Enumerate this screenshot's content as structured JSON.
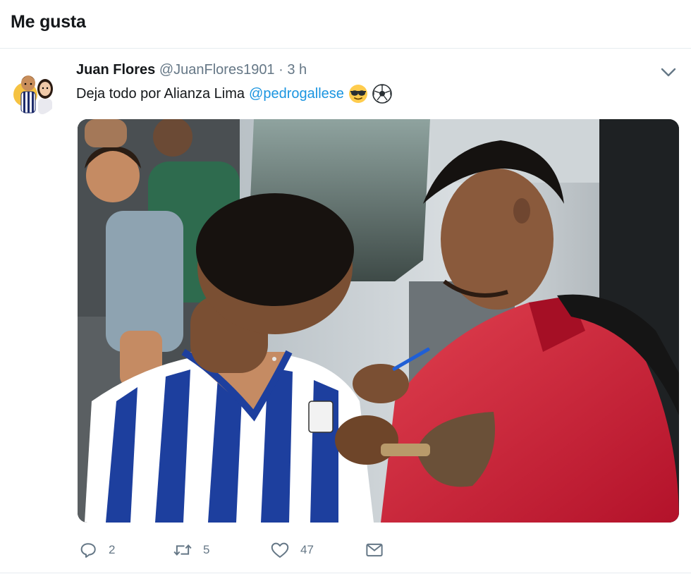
{
  "header": {
    "title": "Me gusta"
  },
  "tweet": {
    "author_name": "Juan Flores",
    "author_handle": "@JuanFlores1901",
    "separator": "·",
    "timestamp": "3 h",
    "text": "Deja todo por Alianza Lima",
    "mention": "@pedrogallese",
    "emojis": [
      "sunglasses-emoji",
      "soccer-ball-emoji"
    ]
  },
  "actions": {
    "reply_count": "2",
    "retweet_count": "5",
    "like_count": "47"
  },
  "colors": {
    "link": "#1b95e0",
    "secondary_text": "#657786",
    "border": "#e6ecf0"
  }
}
